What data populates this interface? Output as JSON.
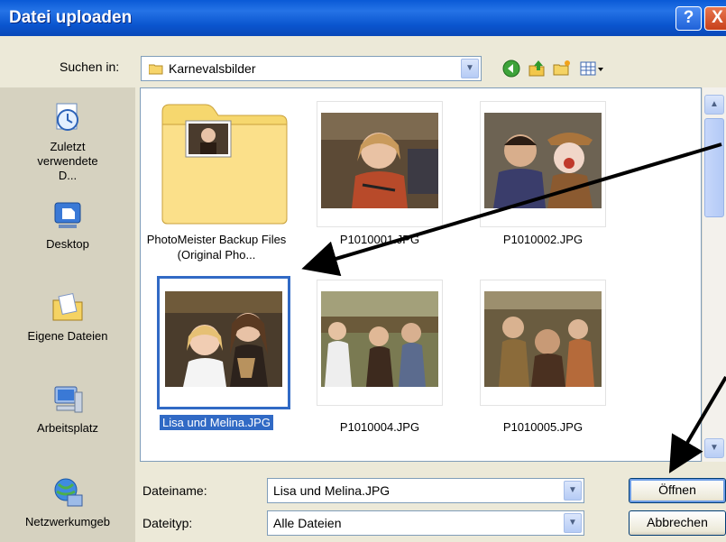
{
  "window": {
    "title": "Datei uploaden",
    "help_glyph": "?",
    "close_glyph": "X"
  },
  "lookin": {
    "label": "Suchen in:",
    "value": "Karnevalsbilder"
  },
  "places": [
    {
      "label": "Zuletzt verwendete D...",
      "icon": "recent-documents-icon"
    },
    {
      "label": "Desktop",
      "icon": "desktop-icon"
    },
    {
      "label": "Eigene Dateien",
      "icon": "my-documents-icon"
    },
    {
      "label": "Arbeitsplatz",
      "icon": "my-computer-icon"
    },
    {
      "label": "Netzwerkumgeb",
      "icon": "network-icon"
    }
  ],
  "files": [
    {
      "name": "PhotoMeister Backup Files (Original Pho...",
      "type": "folder"
    },
    {
      "name": "P1010001.JPG",
      "type": "image"
    },
    {
      "name": "P1010002.JPG",
      "type": "image"
    },
    {
      "name": "Lisa und Melina.JPG",
      "type": "image",
      "selected": true
    },
    {
      "name": "P1010004.JPG",
      "type": "image"
    },
    {
      "name": "P1010005.JPG",
      "type": "image"
    }
  ],
  "footer": {
    "filename_label": "Dateiname:",
    "filename_value": "Lisa und Melina.JPG",
    "filetype_label": "Dateityp:",
    "filetype_value": "Alle Dateien",
    "open_label": "Öffnen",
    "cancel_label": "Abbrechen"
  },
  "colors": {
    "title_bar": "#0a5ad6",
    "selection": "#316ac5",
    "dialog_bg": "#ece9d8",
    "annotation_arrow": "#000000"
  }
}
